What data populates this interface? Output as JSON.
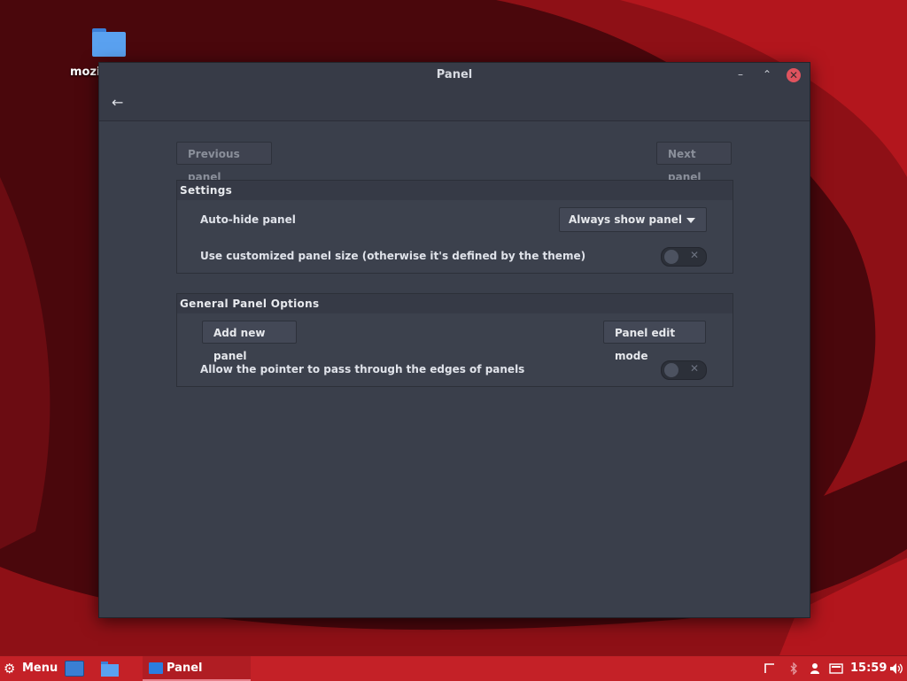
{
  "desktop": {
    "icon_label": "mozil"
  },
  "window": {
    "title": "Panel",
    "buttons": {
      "minimize": "–",
      "maximize": "⌃",
      "close": "✕"
    },
    "back_icon": "←",
    "nav": {
      "previous_label": "Previous panel",
      "next_label": "Next panel"
    },
    "settings": {
      "heading": "Settings",
      "auto_hide_label": "Auto-hide panel",
      "auto_hide_value": "Always show panel",
      "custom_size_label": "Use customized panel size (otherwise it's defined by the theme)",
      "custom_size_on": false
    },
    "general": {
      "heading": "General Panel Options",
      "add_panel_label": "Add new panel",
      "edit_mode_label": "Panel edit mode",
      "pass_through_label": "Allow the pointer to pass through the edges of panels",
      "pass_through_on": false
    }
  },
  "taskbar": {
    "menu_icon": "⚙",
    "menu_label": "Menu",
    "window_label": "Panel",
    "clock": "15:59"
  },
  "colors": {
    "taskbar": "#c42127",
    "window_bg": "#3a3f4b",
    "close": "#e0535e"
  }
}
